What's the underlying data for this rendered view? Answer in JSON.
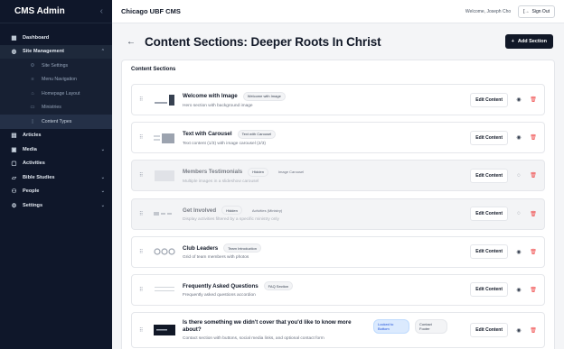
{
  "sidebar": {
    "title": "CMS Admin",
    "collapse_icon": "chevron-left-icon",
    "items": [
      {
        "label": "Dashboard",
        "icon": "grid-icon",
        "chev": ""
      },
      {
        "label": "Site Management",
        "icon": "globe-icon",
        "chev": "⌃"
      },
      {
        "label": "Articles",
        "icon": "document-icon",
        "chev": ""
      },
      {
        "label": "Media",
        "icon": "image-icon",
        "chev": "⌄"
      },
      {
        "label": "Activities",
        "icon": "calendar-icon",
        "chev": ""
      },
      {
        "label": "Bible Studies",
        "icon": "book-icon",
        "chev": "⌄"
      },
      {
        "label": "People",
        "icon": "users-icon",
        "chev": "⌄"
      },
      {
        "label": "Settings",
        "icon": "gear-icon",
        "chev": "⌄"
      }
    ],
    "subitems": [
      {
        "label": "Site Settings",
        "icon": "gear-icon"
      },
      {
        "label": "Menu Navigation",
        "icon": "menu-icon"
      },
      {
        "label": "Homepage Layout",
        "icon": "home-icon"
      },
      {
        "label": "Ministries",
        "icon": "folder-icon"
      },
      {
        "label": "Content Types",
        "icon": "file-icon"
      }
    ]
  },
  "topbar": {
    "app_title": "Chicago UBF CMS",
    "welcome": "Welcome, Joseph Cho",
    "signout": "Sign Out"
  },
  "header": {
    "back_icon": "arrow-left-icon",
    "title": "Content Sections: Deeper Roots In Christ",
    "add_label": "Add Section"
  },
  "card": {
    "title": "Content Sections",
    "rows": [
      {
        "title": "Welcome with Image",
        "badges": [
          "Welcome with Image"
        ],
        "desc": "Hero section with background image",
        "hidden": false,
        "edit": "Edit Content"
      },
      {
        "title": "Text with Carousel",
        "badges": [
          "Text with Carousel"
        ],
        "desc": "Text content (1/3) with image carousel (2/3)",
        "hidden": false,
        "edit": "Edit Content"
      },
      {
        "title": "Members Testimonials",
        "badges": [
          "Hidden",
          "Image Carousel"
        ],
        "desc": "Multiple images in a slideshow carousel",
        "hidden": true,
        "edit": "Edit Content"
      },
      {
        "title": "Get Involved",
        "badges": [
          "Hidden",
          "Activities (Ministry)"
        ],
        "desc": "Display activities filtered by a specific ministry only",
        "hidden": true,
        "edit": "Edit Content"
      },
      {
        "title": "Club Leaders",
        "badges": [
          "Team Introduction"
        ],
        "desc": "Grid of team members with photos",
        "hidden": false,
        "edit": "Edit Content"
      },
      {
        "title": "Frequently Asked Questions",
        "badges": [
          "FAQ Section"
        ],
        "desc": "Frequently asked questions accordion",
        "hidden": false,
        "edit": "Edit Content"
      },
      {
        "title": "Is there something we didn't cover that you'd like to know more about?",
        "badges": [
          "Locked to Bottom",
          "Contact Footer"
        ],
        "desc": "Contact section with buttons, social media links, and optional contact form",
        "hidden": false,
        "edit": "Edit Content"
      }
    ]
  }
}
